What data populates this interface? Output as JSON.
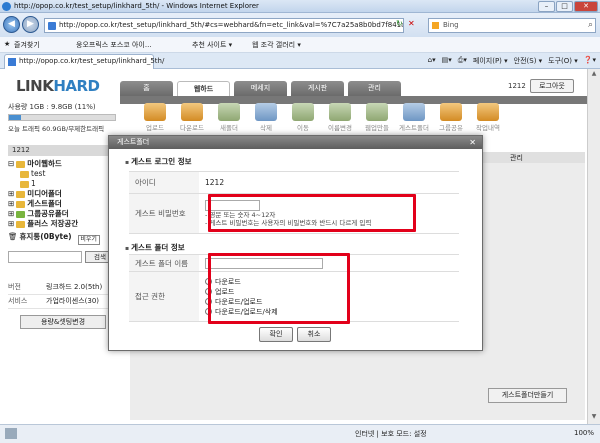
{
  "window": {
    "title": "http://opop.co.kr/test_setup/linkhard_5th/ - Windows Internet Explorer"
  },
  "address": {
    "url": "http://opop.co.kr/test_setup/linkhard_5th/#cs=webhard&fn=etc_link&val=%7C7a25a8b0bd7f841a",
    "search_placeholder": "Bing"
  },
  "favorites": {
    "fav_label": "즐겨찾기",
    "item1": "웅오프릭스 포스코 아이...",
    "item2": "추천 사이트 ▾",
    "item3": "웹 조각 갤러리 ▾"
  },
  "tab": {
    "label": "http://opop.co.kr/test_setup/linkhard_5th/"
  },
  "commands": {
    "page": "페이지(P) ▾",
    "safety": "안전(S) ▾",
    "tools": "도구(O) ▾",
    "help": "❓▾"
  },
  "site": {
    "logo_a": "LINK",
    "logo_b": "HARD",
    "nav": [
      "홈",
      "웹하드",
      "메세지",
      "게시판",
      "관리"
    ],
    "user": "1212",
    "logout": "로그아웃",
    "usage": "사용량 1GB : 9.8GB (11%)",
    "usage_percent": 11,
    "traffic": "오늘 트래픽 60.9GB/무제한트래픽",
    "panel_head": "1212",
    "tree": [
      "마이웹하드",
      "test",
      "1",
      "미디어폴더",
      "게스트폴더",
      "그룹공유폴더",
      "플러스 저장공간",
      "휴지통(0Byte)"
    ],
    "search_btn": "검색",
    "empty_btn": "비우기",
    "info": [
      [
        "버전",
        "링크하드 2.0(5th)"
      ],
      [
        "서비스",
        "가업라이센스(30)"
      ]
    ],
    "capacity_btn": "용량&셋팅변경",
    "tools": [
      "업로드",
      "다운로드",
      "새폴더",
      "삭제",
      "이동",
      "이름변경",
      "웹업만들",
      "게스트폴더",
      "그룹공유",
      "작업내역"
    ],
    "col_manage": "관리",
    "make_guest_btn": "게스트폴더만들기"
  },
  "modal": {
    "title": "게스트폴더",
    "sec_login": "게스트 로그인 정보",
    "id_label": "아이디",
    "id_value": "1212",
    "pw_label": "게스트 비밀번호",
    "pw_note1": "- 영문 또는 숫자 4~12자",
    "pw_note2": "- 게스트 비밀번호는 사용자의 비밀번호와 반드시 다르게 입력",
    "sec_folder": "게스트 폴더 정보",
    "name_label": "게스트 폴더 이름",
    "perm_label": "접근 권한",
    "perms": [
      "다운로드",
      "업로드",
      "다운로드/업로드",
      "다운로드/업로드/삭제"
    ],
    "selected_perm": 0,
    "ok": "확인",
    "cancel": "취소"
  },
  "status": {
    "zone": "인터넷 | 보호 모드: 설정",
    "zoom": "100%"
  }
}
